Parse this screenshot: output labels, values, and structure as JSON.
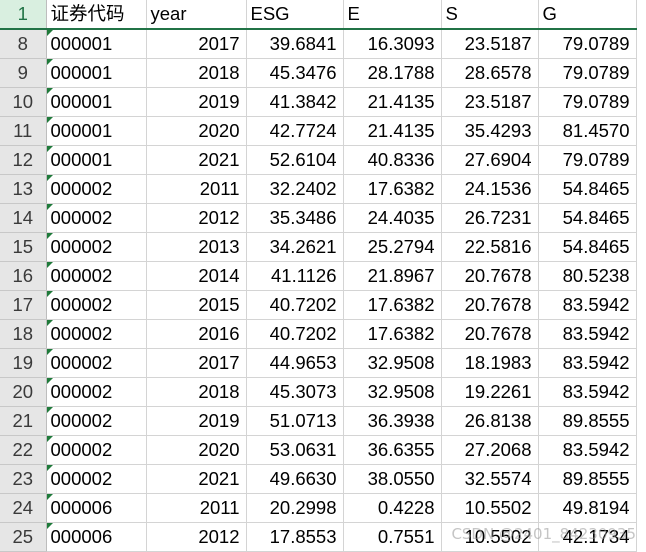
{
  "header_row": {
    "row_number": "1",
    "cells": [
      "证券代码",
      "year",
      "ESG",
      "E",
      "S",
      "G"
    ]
  },
  "rows": [
    {
      "n": "8",
      "code": "000001",
      "year": "2017",
      "esg": "39.6841",
      "e": "16.3093",
      "s": "23.5187",
      "g": "79.0789"
    },
    {
      "n": "9",
      "code": "000001",
      "year": "2018",
      "esg": "45.3476",
      "e": "28.1788",
      "s": "28.6578",
      "g": "79.0789"
    },
    {
      "n": "10",
      "code": "000001",
      "year": "2019",
      "esg": "41.3842",
      "e": "21.4135",
      "s": "23.5187",
      "g": "79.0789"
    },
    {
      "n": "11",
      "code": "000001",
      "year": "2020",
      "esg": "42.7724",
      "e": "21.4135",
      "s": "35.4293",
      "g": "81.4570"
    },
    {
      "n": "12",
      "code": "000001",
      "year": "2021",
      "esg": "52.6104",
      "e": "40.8336",
      "s": "27.6904",
      "g": "79.0789"
    },
    {
      "n": "13",
      "code": "000002",
      "year": "2011",
      "esg": "32.2402",
      "e": "17.6382",
      "s": "24.1536",
      "g": "54.8465"
    },
    {
      "n": "14",
      "code": "000002",
      "year": "2012",
      "esg": "35.3486",
      "e": "24.4035",
      "s": "26.7231",
      "g": "54.8465"
    },
    {
      "n": "15",
      "code": "000002",
      "year": "2013",
      "esg": "34.2621",
      "e": "25.2794",
      "s": "22.5816",
      "g": "54.8465"
    },
    {
      "n": "16",
      "code": "000002",
      "year": "2014",
      "esg": "41.1126",
      "e": "21.8967",
      "s": "20.7678",
      "g": "80.5238"
    },
    {
      "n": "17",
      "code": "000002",
      "year": "2015",
      "esg": "40.7202",
      "e": "17.6382",
      "s": "20.7678",
      "g": "83.5942"
    },
    {
      "n": "18",
      "code": "000002",
      "year": "2016",
      "esg": "40.7202",
      "e": "17.6382",
      "s": "20.7678",
      "g": "83.5942"
    },
    {
      "n": "19",
      "code": "000002",
      "year": "2017",
      "esg": "44.9653",
      "e": "32.9508",
      "s": "18.1983",
      "g": "83.5942"
    },
    {
      "n": "20",
      "code": "000002",
      "year": "2018",
      "esg": "45.3073",
      "e": "32.9508",
      "s": "19.2261",
      "g": "83.5942"
    },
    {
      "n": "21",
      "code": "000002",
      "year": "2019",
      "esg": "51.0713",
      "e": "36.3938",
      "s": "26.8138",
      "g": "89.8555"
    },
    {
      "n": "22",
      "code": "000002",
      "year": "2020",
      "esg": "53.0631",
      "e": "36.6355",
      "s": "27.2068",
      "g": "83.5942"
    },
    {
      "n": "23",
      "code": "000002",
      "year": "2021",
      "esg": "49.6630",
      "e": "38.0550",
      "s": "32.5574",
      "g": "89.8555"
    },
    {
      "n": "24",
      "code": "000006",
      "year": "2011",
      "esg": "20.2998",
      "e": "0.4228",
      "s": "10.5502",
      "g": "49.8194"
    },
    {
      "n": "25",
      "code": "000006",
      "year": "2012",
      "esg": "17.8553",
      "e": "0.7551",
      "s": "10.5502",
      "g": "42.1734"
    }
  ],
  "watermark": "CSDN @2401_84230935",
  "colors": {
    "header_accent": "#217346",
    "row_header_bg": "#e6e6e6",
    "gridline": "#d4d4d4",
    "text_marker": "#1f7a3a"
  }
}
